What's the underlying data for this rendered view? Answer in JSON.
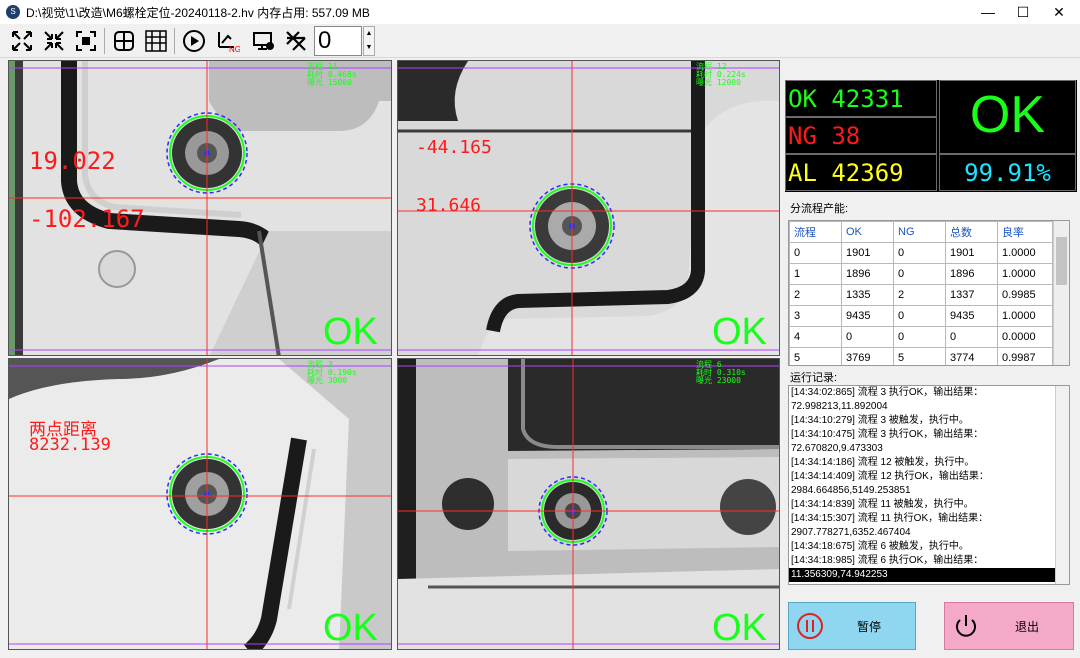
{
  "window": {
    "title": "D:\\视觉\\1\\改造\\M6螺栓定位-20240118-2.hv  内存占用: 557.09 MB",
    "app_icon_letter": "S",
    "minimize": "—",
    "maximize": "☐",
    "close": "✕"
  },
  "toolbar": {
    "counter_value": "0",
    "ng_tag": "NG",
    "icons": [
      "fit-window-icon",
      "shrink-icon",
      "fullscreen-icon",
      "crosshair-icon",
      "grid-layout-icon",
      "run-icon",
      "ng-image-icon",
      "camera-settings-icon",
      "calibrate-icon"
    ]
  },
  "cameras": [
    {
      "info": [
        "流程 11",
        "耗时 0.468s",
        "曝光 15000"
      ],
      "meas": [
        "19.022",
        "-102.167"
      ],
      "result": "OK"
    },
    {
      "info": [
        "流程 12",
        "耗时 0.224s",
        "曝光 12000"
      ],
      "meas": [
        "-44.165",
        "31.646"
      ],
      "result": "OK"
    },
    {
      "info": [
        "流程 3",
        "耗时 0.190s",
        "曝光 3000"
      ],
      "meas": [
        "两点距离",
        "8232.139"
      ],
      "result": "OK"
    },
    {
      "info": [
        "流程 6",
        "耗时 0.310s",
        "曝光 23000"
      ],
      "meas": [],
      "result": "OK"
    }
  ],
  "stats": {
    "ok_label": "OK 42331",
    "ng_label": "NG 38",
    "al_label": "AL 42369",
    "result": "OK",
    "yield": "99.91%",
    "colors": {
      "ok": "#19ff19",
      "ng": "#ff1a1a",
      "al": "#ffff19",
      "yield": "#19e6ff"
    }
  },
  "process_table": {
    "section_label": "分流程产能:",
    "headers": [
      "流程",
      "OK",
      "NG",
      "总数",
      "良率"
    ],
    "rows": [
      [
        "0",
        "1901",
        "0",
        "1901",
        "1.0000"
      ],
      [
        "1",
        "1896",
        "0",
        "1896",
        "1.0000"
      ],
      [
        "2",
        "1335",
        "2",
        "1337",
        "0.9985"
      ],
      [
        "3",
        "9435",
        "0",
        "9435",
        "1.0000"
      ],
      [
        "4",
        "0",
        "0",
        "0",
        "0.0000"
      ],
      [
        "5",
        "3769",
        "5",
        "3774",
        "0.9987"
      ]
    ]
  },
  "log": {
    "section_label": "运行记录:",
    "lines": [
      "[14:34:02:865] 流程 3 执行OK，输出结果：",
      "72.998213,11.892004",
      "[14:34:10:279] 流程 3 被触发，执行中。",
      "[14:34:10:475] 流程 3 执行OK，输出结果：",
      "72.670820,9.473303",
      "[14:34:14:186] 流程 12 被触发，执行中。",
      "[14:34:14:409] 流程 12 执行OK，输出结果：",
      "2984.664856,5149.253851",
      "[14:34:14:839] 流程 11 被触发，执行中。",
      "[14:34:15:307] 流程 11 执行OK，输出结果：",
      "2907.778271,6352.467404",
      "[14:34:18:675] 流程 6 被触发，执行中。",
      "[14:34:18:985] 流程 6 执行OK，输出结果："
    ],
    "selected_line": "11.356309,74.942253"
  },
  "buttons": {
    "pause": "暂停",
    "exit": "退出"
  }
}
